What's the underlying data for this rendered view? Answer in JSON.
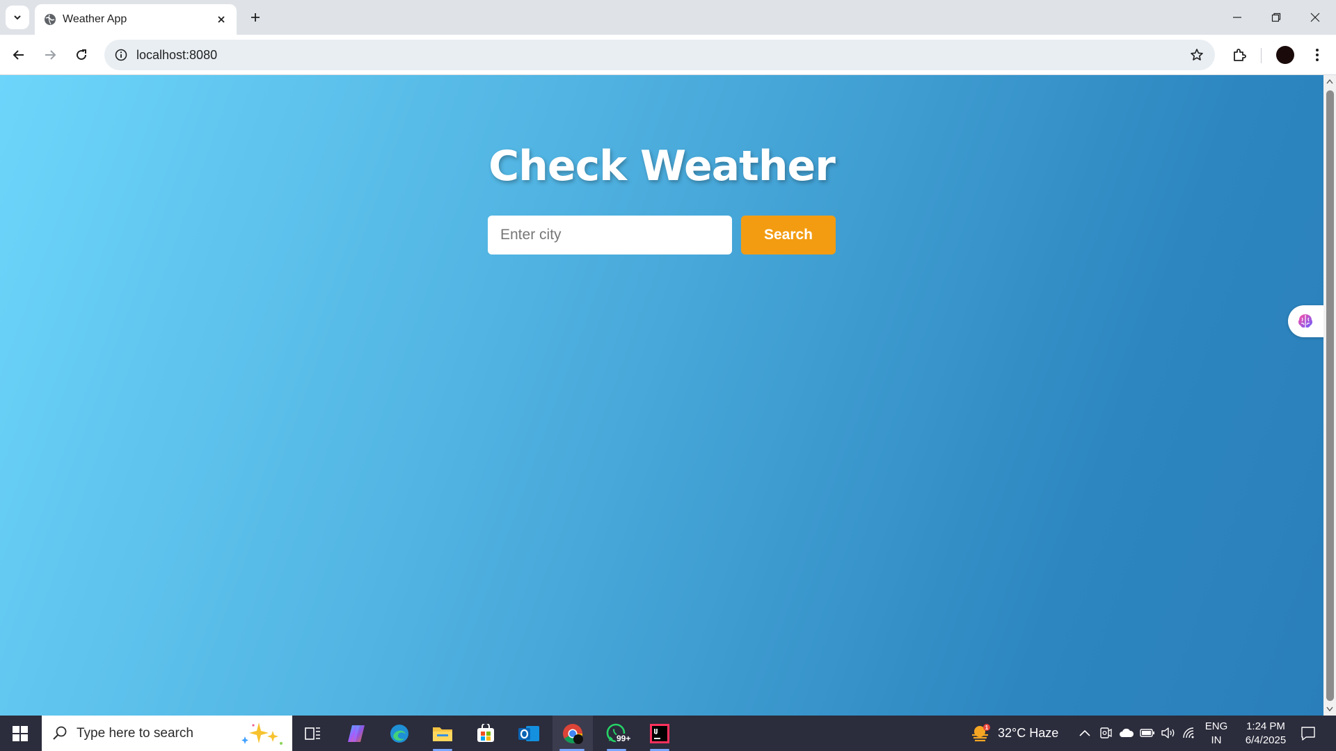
{
  "browser": {
    "tab_title": "Weather App",
    "url": "localhost:8080"
  },
  "page": {
    "title": "Check Weather",
    "city_placeholder": "Enter city",
    "search_button": "Search"
  },
  "taskbar": {
    "search_placeholder": "Type here to search",
    "whatsapp_badge": "99+",
    "weather": "32°C  Haze",
    "weather_alert": "1",
    "lang_top": "ENG",
    "lang_bottom": "IN",
    "time": "1:24 PM",
    "date": "6/4/2025"
  },
  "colors": {
    "search_button": "#f39c12",
    "gradient_start": "#6dd5fa",
    "gradient_end": "#2a7fba",
    "taskbar": "#2b2c3c"
  }
}
